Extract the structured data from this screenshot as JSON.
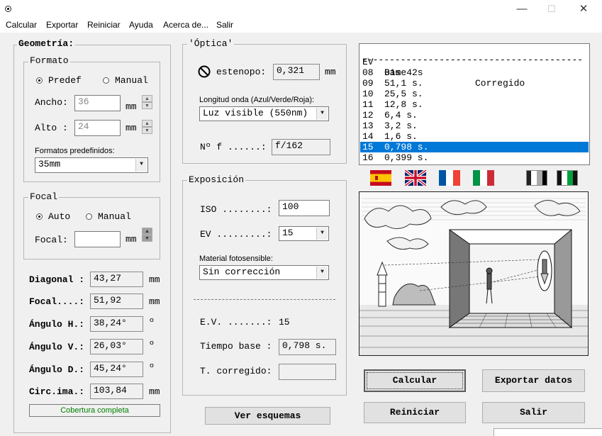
{
  "window": {
    "minimize": "—",
    "maximize": "☐",
    "close": "✕"
  },
  "menu": [
    "Calcular",
    "Exportar",
    "Reiniciar",
    "Ayuda",
    "Acerca de...",
    "Salir"
  ],
  "geometria": {
    "title": "Geometría:",
    "formato": {
      "title": "Formato",
      "radio_predef": "Predef",
      "radio_manual": "Manual",
      "selected": "Predef",
      "ancho_label": "Ancho:",
      "ancho_value": "36",
      "ancho_unit": "mm",
      "alto_label": "Alto :",
      "alto_value": "24",
      "alto_unit": "mm",
      "formatos_label": "Formatos predefinidos:",
      "formato_value": "35mm"
    },
    "focal": {
      "title": "Focal",
      "radio_auto": "Auto",
      "radio_manual": "Manual",
      "selected": "Auto",
      "focal_label": "Focal:",
      "focal_value": "",
      "focal_unit": "mm"
    },
    "results": [
      {
        "label": "Diagonal :",
        "value": "43,27",
        "unit": "mm"
      },
      {
        "label": "Focal....:",
        "value": "51,92",
        "unit": "mm"
      },
      {
        "label": "Ángulo H.:",
        "value": "38,24°",
        "unit": "º"
      },
      {
        "label": "Ángulo V.:",
        "value": "26,03°",
        "unit": "º"
      },
      {
        "label": "Ángulo D.:",
        "value": "45,24°",
        "unit": "º"
      },
      {
        "label": "Circ.ima.:",
        "value": "103,84",
        "unit": "mm"
      }
    ],
    "cobertura": "Cobertura completa"
  },
  "optica": {
    "title": "'Óptica'",
    "estenopo_label": "estenopo:",
    "estenopo_value": "0,321",
    "estenopo_unit": "mm",
    "longitud_label": "Longitud onda (Azul/Verde/Roja):",
    "longitud_value": "Luz visible (550nm)",
    "nf_label": "Nº f ......:",
    "nf_value": "f/162"
  },
  "exposicion": {
    "title": "Exposición",
    "iso_label": "ISO ........:",
    "iso_value": "100",
    "ev_label": "EV .........:",
    "ev_value": "15",
    "material_label": "Material fotosensible:",
    "material_value": "Sin corrección",
    "ev_result_label": "E.V. .......:",
    "ev_result_value": "15",
    "tiempo_label": "Tiempo base :",
    "tiempo_value": "0,798 s.",
    "corregido_label": "T. corregido:",
    "corregido_value": ""
  },
  "table": {
    "headers": [
      "EV",
      "Base",
      "Corregido"
    ],
    "separator": "----------------------------------------",
    "rows": [
      {
        "ev": "08",
        "base": "01m 42s"
      },
      {
        "ev": "09",
        "base": "51,1 s."
      },
      {
        "ev": "10",
        "base": "25,5 s."
      },
      {
        "ev": "11",
        "base": "12,8 s."
      },
      {
        "ev": "12",
        "base": "6,4 s."
      },
      {
        "ev": "13",
        "base": "3,2 s."
      },
      {
        "ev": "14",
        "base": "1,6 s."
      },
      {
        "ev": "15",
        "base": "0,798 s."
      },
      {
        "ev": "16",
        "base": "0,399 s."
      }
    ],
    "selected_ev": "15"
  },
  "flags": [
    "spain-flag",
    "uk-flag",
    "france-flag",
    "italy-flag",
    "bw-mode",
    "green-mode"
  ],
  "buttons": {
    "ver_esquemas": "Ver esquemas",
    "calcular": "Calcular",
    "exportar": "Exportar datos",
    "reiniciar": "Reiniciar",
    "salir": "Salir"
  },
  "colors": {
    "selection": "#0078d7",
    "cobertura_text": "#008000"
  }
}
